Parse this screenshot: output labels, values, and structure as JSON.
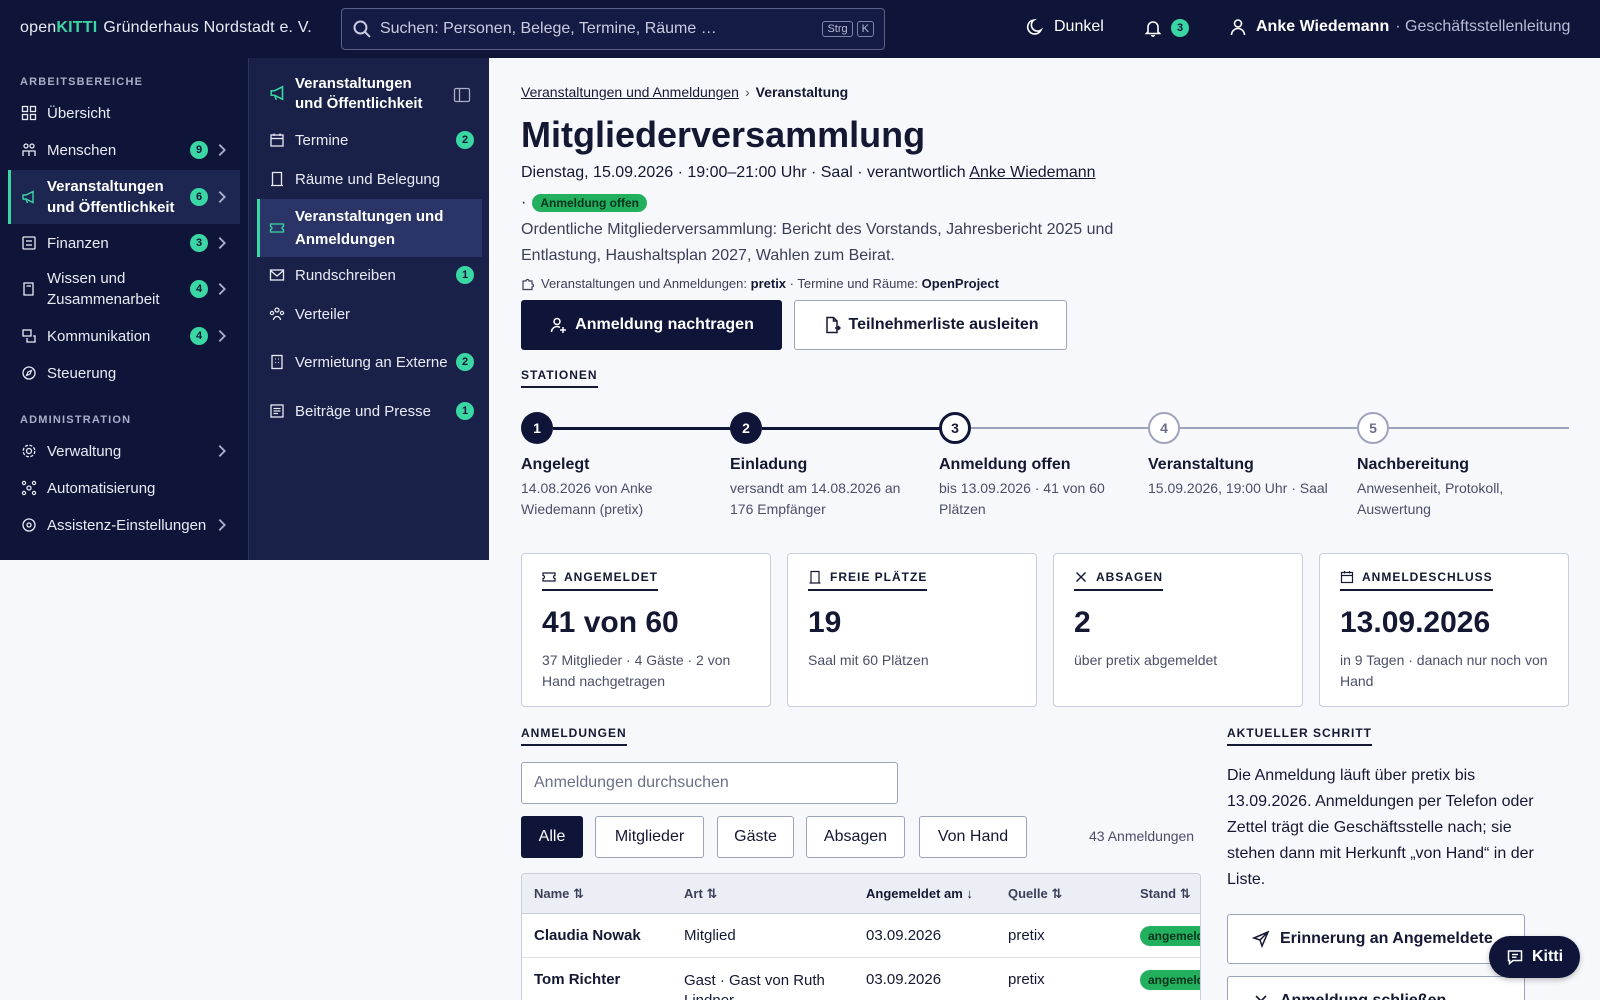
{
  "topbar": {
    "brand_open": "open",
    "brand_kitti": "KITTI",
    "org": "Gründerhaus Nordstadt e. V.",
    "search_placeholder": "Suchen: Personen, Belege, Termine, Räume …",
    "kbd1": "Strg",
    "kbd2": "K",
    "theme_label": "Dunkel",
    "notifications": "3",
    "user_name": "Anke Wiedemann",
    "user_role": "· Geschäftsstellenleitung"
  },
  "sidebar": {
    "section1": "ARBEITSBEREICHE",
    "section2": "ADMINISTRATION",
    "items": [
      {
        "label": "Übersicht"
      },
      {
        "label": "Menschen",
        "badge": "9"
      },
      {
        "label": "Veranstaltungen und Öffentlichkeit",
        "badge": "6"
      },
      {
        "label": "Finanzen",
        "badge": "3"
      },
      {
        "label": "Wissen und Zusammenarbeit",
        "badge": "4"
      },
      {
        "label": "Kommunikation",
        "badge": "4"
      },
      {
        "label": "Steuerung"
      },
      {
        "label": "Verwaltung"
      },
      {
        "label": "Automatisierung"
      },
      {
        "label": "Assistenz-Einstellungen"
      }
    ]
  },
  "subnav": {
    "title": "Veranstaltungen und Öffentlichkeit",
    "items": [
      {
        "label": "Termine",
        "badge": "2"
      },
      {
        "label": "Räume und Belegung"
      },
      {
        "label": "Veranstaltungen und Anmeldungen"
      },
      {
        "label": "Rundschreiben",
        "badge": "1"
      },
      {
        "label": "Verteiler"
      },
      {
        "label": "Vermietung an Externe",
        "badge": "2"
      },
      {
        "label": "Beiträge und Presse",
        "badge": "1"
      }
    ]
  },
  "page": {
    "crumb_parent": "Veranstaltungen und Anmeldungen",
    "crumb_current": "Veranstaltung",
    "title": "Mitgliederversammlung",
    "meta": "Dienstag, 15.09.2026 · 19:00–21:00 Uhr · Saal · verantwortlich",
    "meta_person": "Anke Wiedemann",
    "dot": "·",
    "status": "Anmeldung offen",
    "description": "Ordentliche Mitgliederversammlung: Bericht des Vorstands, Jahresbericht 2025 und Entlastung, Haushaltsplan 2027, Wahlen zum Beirat.",
    "tools_label1": "Veranstaltungen und Anmeldungen:",
    "tools_value1": "pretix",
    "tools_label2": "· Termine und Räume:",
    "tools_value2": "OpenProject",
    "btn_primary": "Anmeldung nachtragen",
    "btn_secondary": "Teilnehmerliste ausleiten"
  },
  "stations": {
    "heading": "STATIONEN",
    "steps": [
      {
        "num": "1",
        "title": "Angelegt",
        "sub": "14.08.2026 von Anke Wiedemann (pretix)"
      },
      {
        "num": "2",
        "title": "Einladung",
        "sub": "versandt am 14.08.2026 an 176 Empfänger"
      },
      {
        "num": "3",
        "title": "Anmeldung offen",
        "sub": "bis 13.09.2026 · 41 von 60 Plätzen"
      },
      {
        "num": "4",
        "title": "Veranstaltung",
        "sub": "15.09.2026, 19:00 Uhr · Saal"
      },
      {
        "num": "5",
        "title": "Nachbereitung",
        "sub": "Anwesenheit, Protokoll, Auswertung"
      }
    ]
  },
  "cards": [
    {
      "label": "ANGEMELDET",
      "value": "41 von 60",
      "sub": "37 Mitglieder · 4 Gäste · 2 von Hand nachgetragen"
    },
    {
      "label": "FREIE PLÄTZE",
      "value": "19",
      "sub": "Saal mit 60 Plätzen"
    },
    {
      "label": "ABSAGEN",
      "value": "2",
      "sub": "über pretix abgemeldet"
    },
    {
      "label": "ANMELDESCHLUSS",
      "value": "13.09.2026",
      "sub": "in 9 Tagen · danach nur noch von Hand"
    }
  ],
  "registrations": {
    "heading": "ANMELDUNGEN",
    "search_placeholder": "Anmeldungen durchsuchen",
    "filters": [
      "Alle",
      "Mitglieder",
      "Gäste",
      "Absagen",
      "Von Hand"
    ],
    "count": "43 Anmeldungen",
    "columns": [
      "Name ⇅",
      "Art ⇅",
      "Angemeldet am ↓",
      "Quelle ⇅",
      "Stand ⇅"
    ],
    "rows": [
      {
        "name": "Claudia Nowak",
        "type": "Mitglied",
        "date": "03.09.2026",
        "source": "pretix",
        "status": "angemeldet"
      },
      {
        "name": "Tom Richter",
        "type": "Gast · Gast von Ruth Lindner",
        "date": "03.09.2026",
        "source": "pretix",
        "status": "angemeldet"
      }
    ]
  },
  "current_step": {
    "heading": "AKTUELLER SCHRITT",
    "text": "Die Anmeldung läuft über pretix bis 13.09.2026. Anmeldungen per Telefon oder Zettel trägt die Geschäftsstelle nach; sie stehen dann mit Herkunft „von Hand“ in der Liste.",
    "btn_remind": "Erinnerung an Angemeldete",
    "btn_close": "Anmeldung schließen"
  },
  "assistant": {
    "label": "Kitti"
  },
  "colors": {
    "navy": "#0f1538",
    "accent": "#3ad6a4",
    "status_green": "#22b05f"
  }
}
